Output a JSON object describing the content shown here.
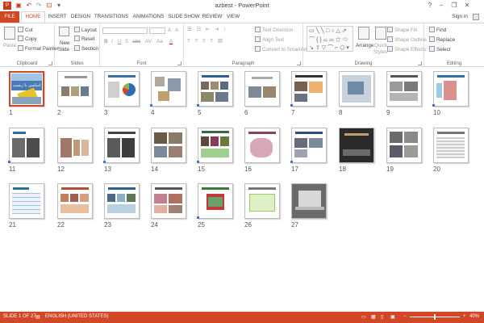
{
  "titlebar": {
    "title": "azbest - PowerPoint",
    "help": "?",
    "min": "–",
    "restore": "❐",
    "close": "✕"
  },
  "tabs": [
    "FILE",
    "HOME",
    "INSERT",
    "DESIGN",
    "TRANSITIONS",
    "ANIMATIONS",
    "SLIDE SHOW",
    "REVIEW",
    "VIEW"
  ],
  "account": {
    "signin": "Sign in"
  },
  "ribbon": {
    "clipboard": {
      "label": "Clipboard",
      "paste": "Paste",
      "cut": "Cut",
      "copy": "Copy",
      "format_painter": "Format Painter"
    },
    "slides": {
      "label": "Slides",
      "new_slide": "New",
      "new_slide2": "Slide",
      "layout": "Layout",
      "reset": "Reset",
      "section": "Section"
    },
    "font": {
      "label": "Font",
      "bold": "B",
      "italic": "I",
      "underline": "U",
      "strike": "S",
      "abc": "abc",
      "av": "AV",
      "aa": "Aa",
      "font_color": "A"
    },
    "paragraph": {
      "label": "Paragraph",
      "text_direction": "Text Direction",
      "align_text": "Align Text",
      "convert_smartart": "Convert to SmartArt"
    },
    "drawing": {
      "label": "Drawing",
      "arrange": "Arrange",
      "quick_styles": "Quick",
      "quick_styles2": "Styles",
      "shape_fill": "Shape Fill",
      "shape_outline": "Shape Outline",
      "shape_effects": "Shape Effects"
    },
    "editing": {
      "label": "Editing",
      "find": "Find",
      "replace": "Replace",
      "select": "Select"
    }
  },
  "slide1_text": "اساسی با زبست",
  "slides": [
    "1",
    "2",
    "3",
    "4",
    "5",
    "6",
    "7",
    "8",
    "9",
    "10",
    "11",
    "12",
    "13",
    "14",
    "15",
    "16",
    "17",
    "18",
    "19",
    "20",
    "21",
    "22",
    "23",
    "24",
    "25",
    "26",
    "27"
  ],
  "status": {
    "slide": "SLIDE 1 OF 27",
    "language": "ENGLISH (UNITED STATES)",
    "zoom": "40%",
    "minus": "−",
    "plus": "+"
  },
  "colors": {
    "accent": "#d24726"
  }
}
